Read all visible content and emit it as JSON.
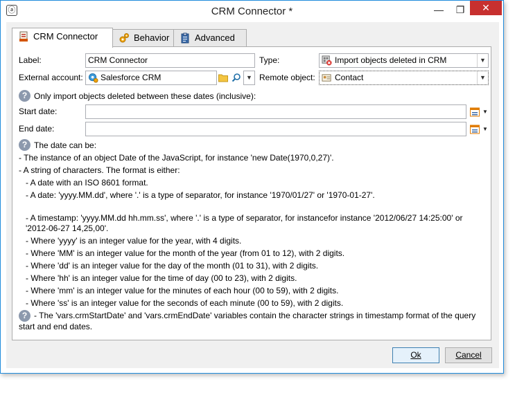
{
  "window": {
    "title": "CRM Connector *",
    "minimize_glyph": "—",
    "restore_glyph": "❐",
    "close_glyph": "✕"
  },
  "tabs": [
    {
      "label": "CRM Connector",
      "icon": "crm-icon",
      "active": true
    },
    {
      "label": "Behavior",
      "icon": "gears-icon",
      "active": false
    },
    {
      "label": "Advanced",
      "icon": "clipboard-icon",
      "active": false
    }
  ],
  "form": {
    "label_label": "Label:",
    "label_value": "CRM Connector",
    "type_label": "Type:",
    "type_value": "Import objects deleted in CRM",
    "external_account_label": "External account:",
    "external_account_value": "Salesforce CRM",
    "remote_object_label": "Remote object:",
    "remote_object_value": "Contact",
    "dates_hint": "Only import objects deleted between these dates (inclusive):",
    "start_date_label": "Start date:",
    "start_date_value": "",
    "end_date_label": "End date:",
    "end_date_value": ""
  },
  "help": {
    "heading": "The date can be:",
    "lines": [
      "- The instance of an object Date of the JavaScript, for instance 'new Date(1970,0,27)'.",
      "- A string of characters. The format is either:",
      "   - A date with an ISO 8601 format.",
      "   - A date: 'yyyy.MM.dd', where '.' is a type of separator, for instance '1970/01/27' or '1970-01-27'.",
      "",
      "   - A timestamp: 'yyyy.MM.dd hh.mm.ss', where '.' is a type of separator, for instancefor instance '2012/06/27 14:25:00' or",
      "   '2012-06-27 14,25,00'.",
      "   - Where 'yyyy' is an integer value for the year, with 4 digits.",
      "   - Where 'MM' is an integer value for the month of the year (from 01 to 12), with 2 digits.",
      "   - Where 'dd' is an integer value for the day of the month (01 to 31), with 2 digits.",
      "   - Where 'hh' is an integer value for the time of day (00 to 23), with 2 digits.",
      "   - Where 'mm' is an integer value for the minutes of each hour (00 to 59), with 2 digits.",
      "   - Where 'ss' is an integer value for the seconds of each minute (00 to 59), with 2 digits."
    ],
    "vars_line1": "- The 'vars.crmStartDate' and 'vars.crmEndDate' variables contain the character strings in timestamp format of the query",
    "vars_line2": "start and end dates."
  },
  "buttons": {
    "ok": "Ok",
    "cancel": "Cancel"
  },
  "colors": {
    "accent": "#1f8bdc",
    "close": "#c7302f",
    "hint": "#8c99ad"
  }
}
